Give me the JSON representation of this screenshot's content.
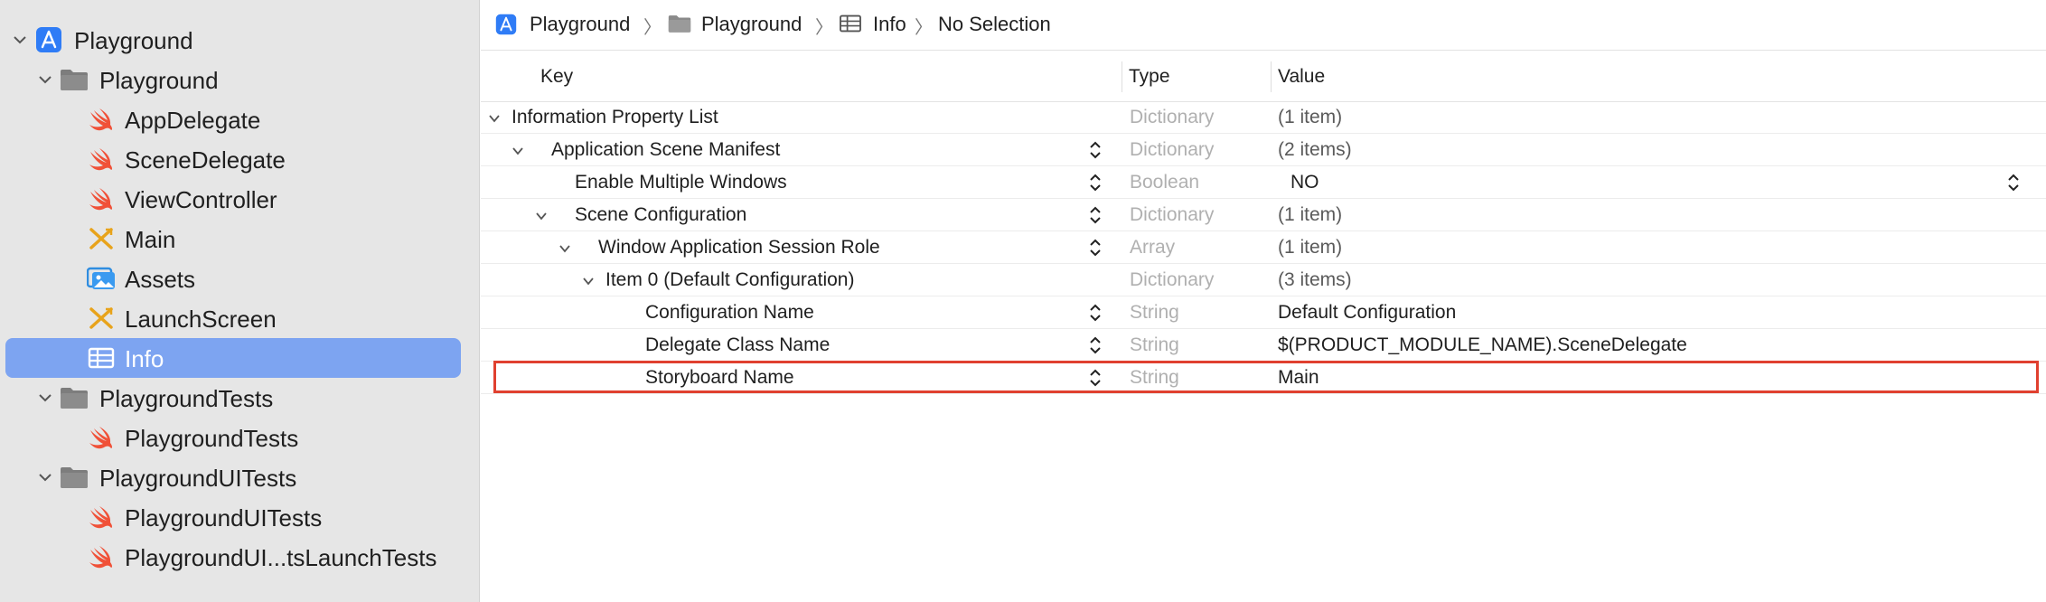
{
  "navigator": {
    "items": [
      {
        "label": "Playground",
        "icon": "app-project-icon"
      },
      {
        "label": "Playground",
        "icon": "folder-icon"
      },
      {
        "label": "AppDelegate",
        "icon": "swift-icon"
      },
      {
        "label": "SceneDelegate",
        "icon": "swift-icon"
      },
      {
        "label": "ViewController",
        "icon": "swift-icon"
      },
      {
        "label": "Main",
        "icon": "storyboard-icon"
      },
      {
        "label": "Assets",
        "icon": "asset-catalog-icon"
      },
      {
        "label": "LaunchScreen",
        "icon": "storyboard-icon"
      },
      {
        "label": "Info",
        "icon": "plist-table-icon"
      },
      {
        "label": "PlaygroundTests",
        "icon": "folder-icon"
      },
      {
        "label": "PlaygroundTests",
        "icon": "swift-icon"
      },
      {
        "label": "PlaygroundUITests",
        "icon": "folder-icon"
      },
      {
        "label": "PlaygroundUITests",
        "icon": "swift-icon"
      },
      {
        "label": "PlaygroundUI...tsLaunchTests",
        "icon": "swift-icon"
      }
    ],
    "selected_label": "Info"
  },
  "breadcrumb": {
    "items": [
      "Playground",
      "Playground",
      "Info",
      "No Selection"
    ]
  },
  "columns": {
    "key": "Key",
    "type": "Type",
    "value": "Value"
  },
  "plist": {
    "rows": [
      {
        "key": "Information Property List",
        "type": "Dictionary",
        "value": "(1 item)"
      },
      {
        "key": "Application Scene Manifest",
        "type": "Dictionary",
        "value": "(2 items)"
      },
      {
        "key": "Enable Multiple Windows",
        "type": "Boolean",
        "value": "NO"
      },
      {
        "key": "Scene Configuration",
        "type": "Dictionary",
        "value": "(1 item)"
      },
      {
        "key": "Window Application Session Role",
        "type": "Array",
        "value": "(1 item)"
      },
      {
        "key": "Item 0 (Default Configuration)",
        "type": "Dictionary",
        "value": "(3 items)"
      },
      {
        "key": "Configuration Name",
        "type": "String",
        "value": "Default Configuration"
      },
      {
        "key": "Delegate Class Name",
        "type": "String",
        "value": "$(PRODUCT_MODULE_NAME).SceneDelegate"
      },
      {
        "key": "Storyboard Name",
        "type": "String",
        "value": "Main"
      }
    ]
  },
  "colors": {
    "selection": "#7da4f1",
    "highlight_border": "#e0402f",
    "swift": "#f05138",
    "folder": "#7d7d7d"
  }
}
